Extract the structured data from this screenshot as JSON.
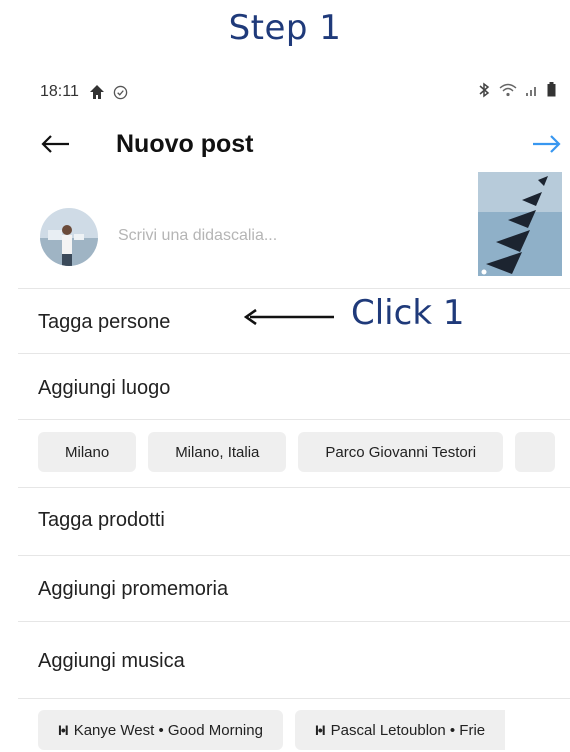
{
  "annotation": {
    "step_title": "Step 1",
    "click_label": "Click 1"
  },
  "status_bar": {
    "time": "18:11"
  },
  "header": {
    "title": "Nuovo post"
  },
  "caption": {
    "placeholder": "Scrivi una didascalia..."
  },
  "menu": {
    "tag_people": "Tagga persone",
    "add_location": "Aggiungi luogo",
    "tag_products": "Tagga prodotti",
    "add_reminder": "Aggiungi promemoria",
    "add_music": "Aggiungi musica"
  },
  "location_chips": [
    "Milano",
    "Milano, Italia",
    "Parco Giovanni Testori"
  ],
  "music_chips": [
    {
      "icon": "music-bars-icon",
      "label": "Kanye West • Good Morning"
    },
    {
      "icon": "music-bars-icon",
      "label": "Pascal Letoublon • Frie"
    }
  ],
  "colors": {
    "accent": "#3897f0",
    "annotation": "#1f3a7a",
    "chip_bg": "#efefef"
  }
}
